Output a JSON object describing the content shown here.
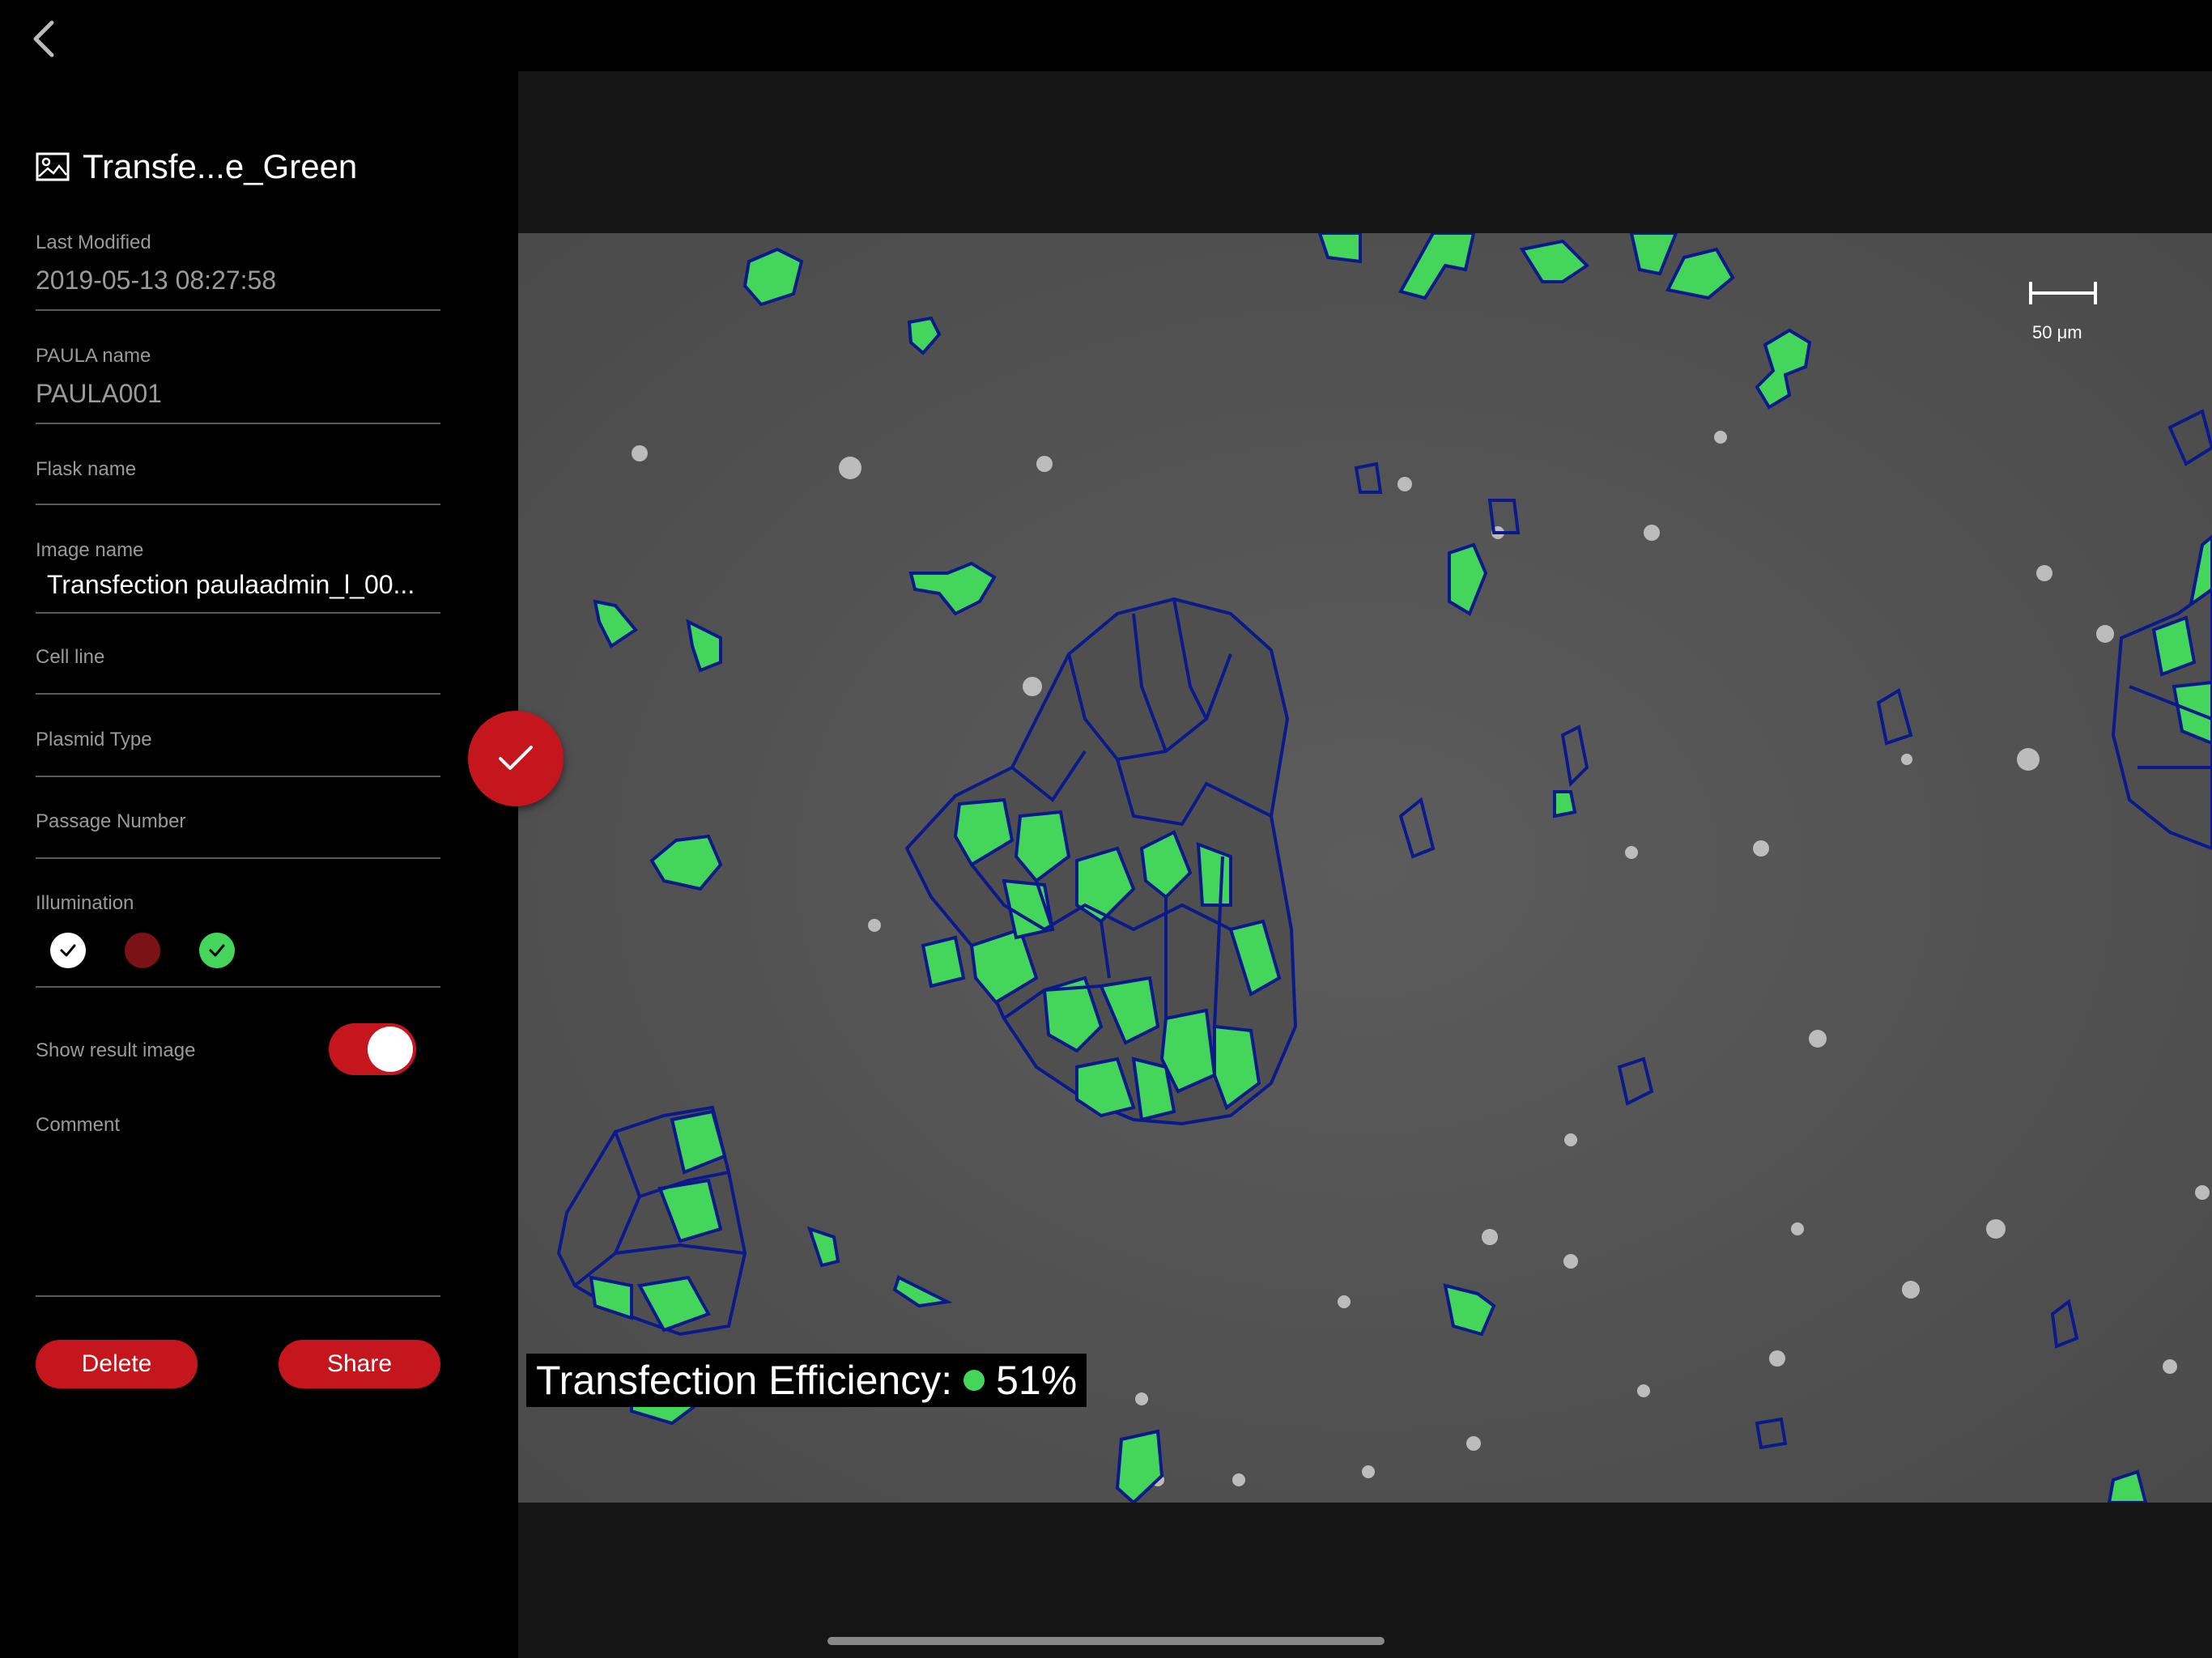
{
  "header": {
    "title": "Transfe...e_Green",
    "title_icon": "image-icon"
  },
  "fields": {
    "last_modified": {
      "label": "Last Modified",
      "value": "2019-05-13 08:27:58"
    },
    "paula_name": {
      "label": "PAULA name",
      "value": "PAULA001"
    },
    "flask_name": {
      "label": "Flask name",
      "value": ""
    },
    "image_name": {
      "label": "Image name",
      "value": "Transfection paulaadmin_l_00..."
    },
    "cell_line": {
      "label": "Cell line",
      "value": ""
    },
    "plasmid_type": {
      "label": "Plasmid Type",
      "value": ""
    },
    "passage_number": {
      "label": "Passage Number",
      "value": ""
    },
    "illumination": {
      "label": "Illumination",
      "options": [
        {
          "name": "white",
          "color": "#ffffff",
          "checked": true
        },
        {
          "name": "red",
          "color": "#7a1216",
          "checked": false
        },
        {
          "name": "green",
          "color": "#43d65a",
          "checked": true
        }
      ]
    },
    "show_result": {
      "label": "Show result image",
      "on": true
    },
    "comment": {
      "label": "Comment",
      "value": ""
    }
  },
  "actions": {
    "delete_label": "Delete",
    "share_label": "Share"
  },
  "viewer": {
    "scale_label": "50 μm",
    "efficiency_label": "Transfection Efficiency:",
    "efficiency_value": "51%"
  },
  "colors": {
    "accent": "#c4161c",
    "cell_green": "#43d65a",
    "outline_blue": "#0a1a8a"
  }
}
